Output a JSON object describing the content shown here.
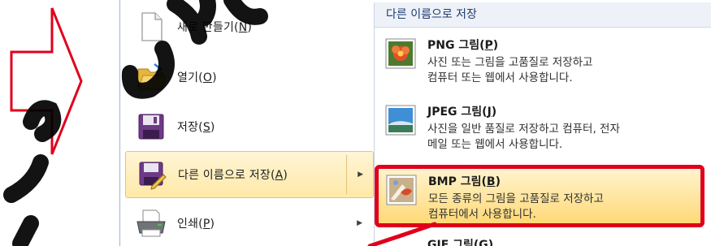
{
  "menu": {
    "commands": [
      {
        "label": "새로 만들기(",
        "key": "N",
        "suffix": ")"
      },
      {
        "label": "열기(",
        "key": "O",
        "suffix": ")"
      },
      {
        "label": "저장(",
        "key": "S",
        "suffix": ")"
      },
      {
        "label": "다른 이름으로 저장(",
        "key": "A",
        "suffix": ")"
      },
      {
        "label": "인쇄(",
        "key": "P",
        "suffix": ")"
      }
    ]
  },
  "submenu": {
    "header": "다른 이름으로 저장",
    "items": [
      {
        "title": "PNG 그림(",
        "key": "P",
        "suffix": ")",
        "desc1": "사진 또는 그림을 고품질로 저장하고",
        "desc2": "컴퓨터 또는 웹에서 사용합니다."
      },
      {
        "title": "JPEG 그림(",
        "key": "J",
        "suffix": ")",
        "desc1": "사진을 일반 품질로 저장하고 컴퓨터, 전자",
        "desc2": "메일 또는 웹에서 사용합니다."
      },
      {
        "title": "BMP 그림(",
        "key": "B",
        "suffix": ")",
        "desc1": "모든 종류의 그림을 고품질로 저장하고",
        "desc2": "컴퓨터에서 사용합니다."
      },
      {
        "title": "GIF 그림(",
        "key": "G",
        "suffix": ")"
      }
    ]
  },
  "colors": {
    "highlight_red": "#e0001b",
    "menu_highlight": "#ffe9a8"
  },
  "icons": [
    "blank-document-icon",
    "open-folder-icon",
    "floppy-disk-icon",
    "save-as-icon",
    "printer-icon",
    "png-flower-icon",
    "jpeg-landscape-icon",
    "bmp-paint-icon"
  ]
}
